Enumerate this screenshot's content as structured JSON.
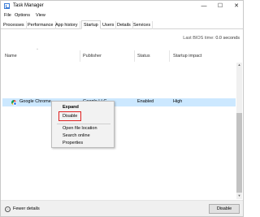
{
  "window": {
    "title": "Task Manager",
    "controls": {
      "minimize": "—",
      "maximize": "☐",
      "close": "✕"
    }
  },
  "menu": {
    "items": [
      "File",
      "Options",
      "View"
    ]
  },
  "tabs": [
    "Processes",
    "Performance",
    "App history",
    "Startup",
    "Users",
    "Details",
    "Services"
  ],
  "active_tab": "Startup",
  "bios": {
    "label": "Last BIOS time:",
    "value": "0.0 seconds"
  },
  "columns": {
    "name": "Name",
    "publisher": "Publisher",
    "status": "Status",
    "impact": "Startup impact"
  },
  "row": {
    "name": "Google Chrome",
    "publisher": "Google LLC",
    "status": "Enabled",
    "impact": "High"
  },
  "context_menu": {
    "expand": "Expand",
    "disable": "Disable",
    "open_file_location": "Open file location",
    "search_online": "Search online",
    "properties": "Properties"
  },
  "footer": {
    "fewer_details": "Fewer details",
    "disable_button": "Disable"
  },
  "colors": {
    "selection": "#cce8ff",
    "highlight_box": "#e02020"
  }
}
